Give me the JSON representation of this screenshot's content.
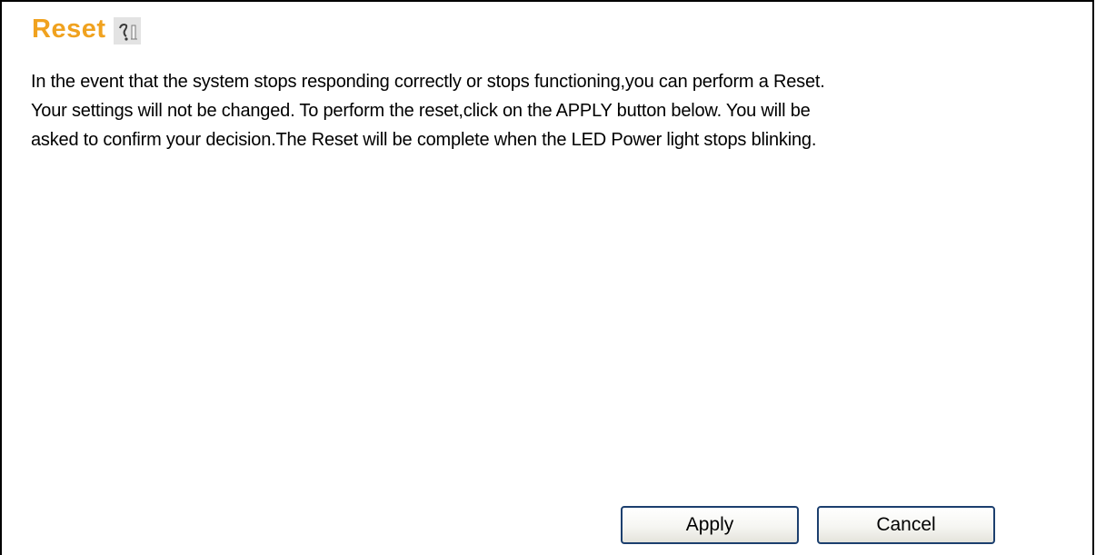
{
  "page": {
    "title": "Reset",
    "help_icon": "help-book-icon",
    "title_color": "#f0a21f"
  },
  "description": {
    "lines": [
      "In the event that the system stops responding correctly or stops functioning,you can perform a Reset.",
      "Your settings will not be changed. To perform the reset,click on the APPLY button below. You will be",
      "asked to confirm your decision.The Reset will be complete when the LED Power light stops blinking."
    ]
  },
  "actions": {
    "apply_label": "Apply",
    "cancel_label": "Cancel"
  }
}
